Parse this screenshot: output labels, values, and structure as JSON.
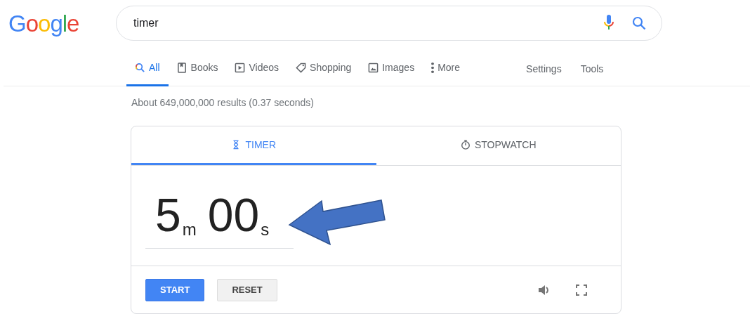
{
  "logo": "Google",
  "search": {
    "value": "timer"
  },
  "tabs": [
    {
      "label": "All",
      "kind": "search",
      "selected": true
    },
    {
      "label": "Books",
      "kind": "book",
      "selected": false
    },
    {
      "label": "Videos",
      "kind": "video",
      "selected": false
    },
    {
      "label": "Shopping",
      "kind": "tag",
      "selected": false
    },
    {
      "label": "Images",
      "kind": "image",
      "selected": false
    },
    {
      "label": "More",
      "kind": "dots",
      "selected": false
    }
  ],
  "tools": [
    "Settings",
    "Tools"
  ],
  "result_stats": "About 649,000,000 results (0.37 seconds)",
  "timer": {
    "tabs": [
      {
        "label": "TIMER",
        "kind": "hourglass",
        "selected": true
      },
      {
        "label": "STOPWATCH",
        "kind": "stopwatch",
        "selected": false
      }
    ],
    "time": [
      {
        "value": "5",
        "unit": "m"
      },
      {
        "value": "00",
        "unit": "s"
      }
    ],
    "buttons": [
      {
        "label": "START",
        "kind": "primary"
      },
      {
        "label": "RESET",
        "kind": "secondary"
      }
    ]
  }
}
